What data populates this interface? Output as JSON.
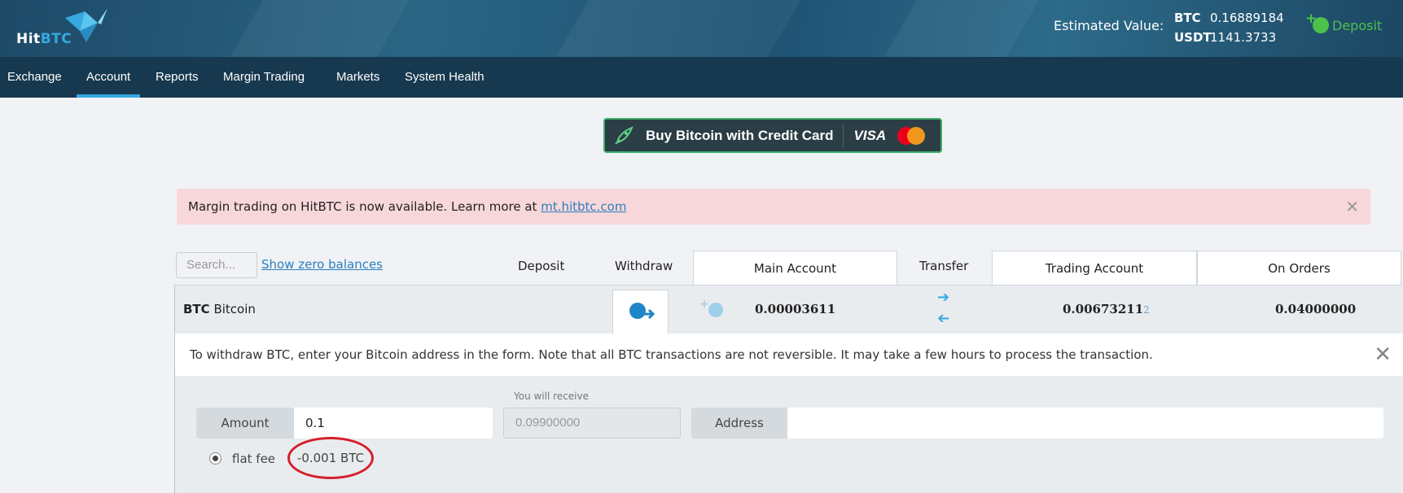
{
  "header": {
    "logo_hit": "Hit",
    "logo_btc": "BTC",
    "estimated_label": "Estimated Value:",
    "balances": [
      {
        "currency": "BTC",
        "value": "0.16889184"
      },
      {
        "currency": "USDT",
        "value": "1141.3733"
      }
    ],
    "deposit_label": "Deposit"
  },
  "nav": {
    "items": [
      {
        "label": "Exchange",
        "active": false
      },
      {
        "label": "Account",
        "active": true
      },
      {
        "label": "Reports",
        "active": false
      },
      {
        "label": "Margin Trading",
        "active": false
      },
      {
        "label": "Markets",
        "active": false
      },
      {
        "label": "System Health",
        "active": false
      }
    ]
  },
  "banner": {
    "text": "Buy Bitcoin with Credit Card",
    "visa": "VISA"
  },
  "alert": {
    "text": "Margin trading on HitBTC is now available. Learn more at ",
    "link": "mt.hitbtc.com",
    "close": "✕"
  },
  "controls": {
    "search_placeholder": "Search...",
    "show_zero": "Show zero balances"
  },
  "columns": {
    "deposit": "Deposit",
    "withdraw": "Withdraw",
    "main_account": "Main Account",
    "transfer": "Transfer",
    "trading_account": "Trading Account",
    "on_orders": "On Orders"
  },
  "row": {
    "ticker": "BTC",
    "name": "Bitcoin",
    "main_balance": "0.00003611",
    "trading_balance": "0.00673211",
    "trading_balance_suffix": "2",
    "on_orders": "0.04000000"
  },
  "withdraw": {
    "info": "To withdraw BTC, enter your Bitcoin address in the form. Note that all BTC transactions are not reversible. It may take a few hours to process the transaction.",
    "close": "✕",
    "amount_label": "Amount",
    "amount_value": "0.1",
    "receive_label": "You will receive",
    "receive_value": "0.09900000",
    "address_label": "Address",
    "address_value": "",
    "fee_label": "flat fee",
    "fee_value": "-0.001 BTC"
  },
  "colors": {
    "header_bg": "#1f5273",
    "nav_bg": "#17394f",
    "accent_blue": "#35a9e0",
    "deposit_green": "#4cc24c",
    "alert_bg": "#f8d7da",
    "annotation_red": "#d4202a"
  },
  "icons": {
    "deposit": "deposit-plus-icon",
    "withdraw": "withdraw-arrow-icon",
    "rocket": "rocket-icon",
    "transfer_right": "arrow-right-icon",
    "transfer_left": "arrow-left-icon"
  }
}
